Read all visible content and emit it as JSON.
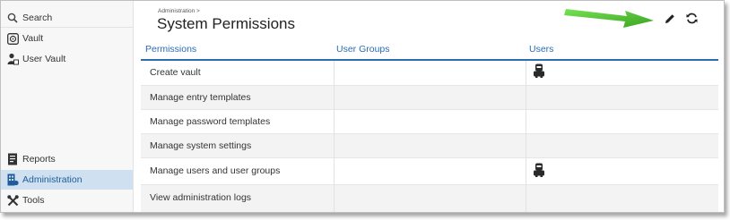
{
  "sidebar": {
    "search": "Search",
    "vault": "Vault",
    "user_vault": "User Vault",
    "reports": "Reports",
    "administration": "Administration",
    "tools": "Tools"
  },
  "page": {
    "breadcrumb": "Administration >",
    "title": "System Permissions"
  },
  "table": {
    "headers": [
      "Permissions",
      "User Groups",
      "Users"
    ],
    "rows": [
      {
        "label": "Create vault",
        "user_groups": "",
        "users_icon": "user-icon"
      },
      {
        "label": "Manage entry templates",
        "user_groups": "",
        "users_icon": ""
      },
      {
        "label": "Manage password templates",
        "user_groups": "",
        "users_icon": ""
      },
      {
        "label": "Manage system settings",
        "user_groups": "",
        "users_icon": ""
      },
      {
        "label": "Manage users and user groups",
        "user_groups": "",
        "users_icon": "user-icon"
      },
      {
        "label": "View administration logs",
        "user_groups": "",
        "users_icon": ""
      }
    ]
  },
  "toolbar": {
    "edit_icon": "pencil-icon",
    "refresh_icon": "refresh-icon",
    "annotation": "green-arrow"
  },
  "colors": {
    "accent": "#2d6eb3",
    "active_nav": "#cfe0f1",
    "arrow": "#3cb521"
  }
}
